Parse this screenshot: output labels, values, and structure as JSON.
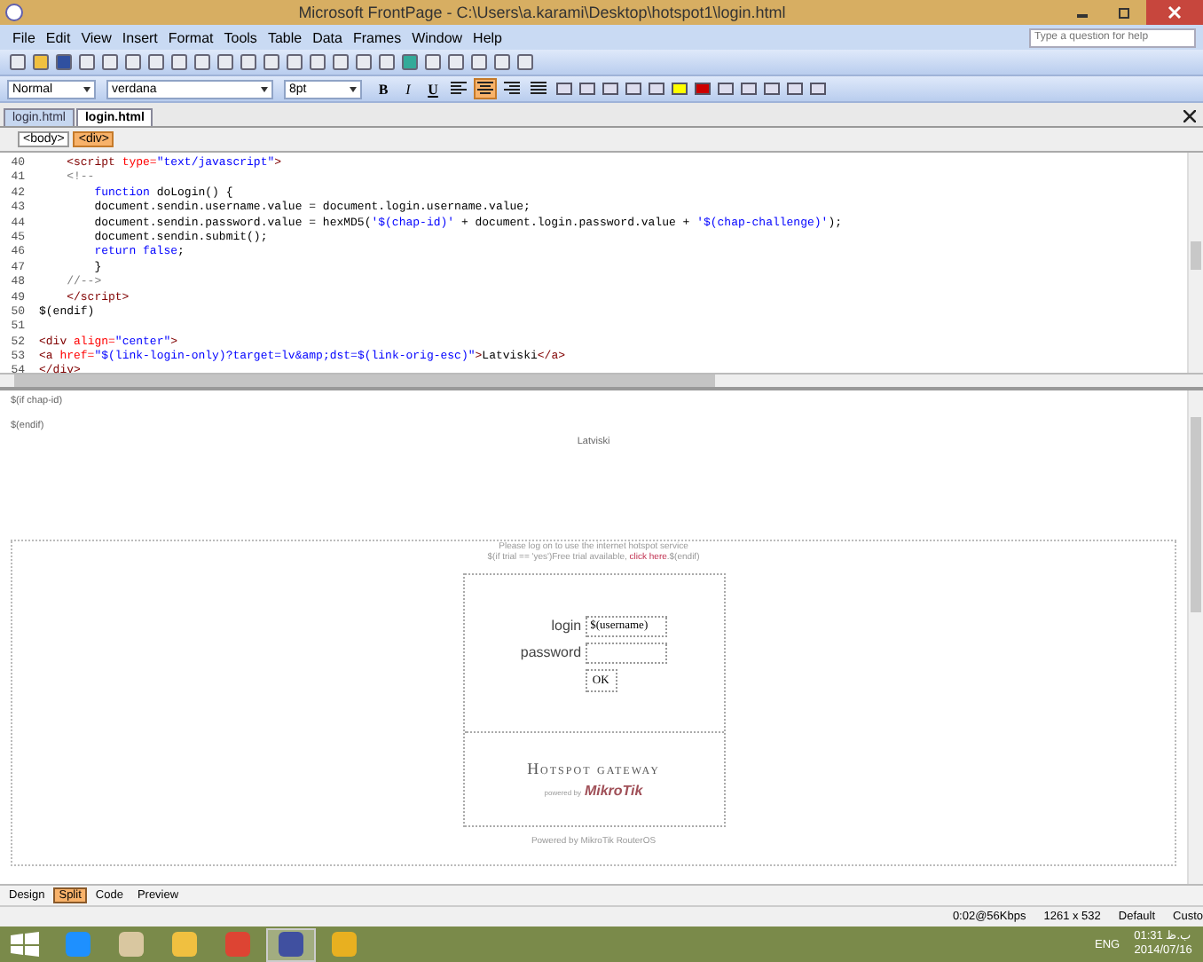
{
  "window": {
    "title": "Microsoft FrontPage - C:\\Users\\a.karami\\Desktop\\hotspot1\\login.html"
  },
  "menu": [
    "File",
    "Edit",
    "View",
    "Insert",
    "Format",
    "Tools",
    "Table",
    "Data",
    "Frames",
    "Window",
    "Help"
  ],
  "help_box": {
    "placeholder": "Type a question for help"
  },
  "format_bar": {
    "style": "Normal",
    "font": "verdana",
    "size": "8pt",
    "bold": "B",
    "italic": "I",
    "underline": "U",
    "alignment": [
      {
        "kind": "left",
        "selected": false
      },
      {
        "kind": "center",
        "selected": true
      },
      {
        "kind": "right",
        "selected": false
      },
      {
        "kind": "justify",
        "selected": false
      }
    ]
  },
  "doc_tabs": [
    {
      "label": "login.html",
      "selected": false
    },
    {
      "label": "login.html",
      "selected": true
    }
  ],
  "tag_path": [
    {
      "label": "<body>",
      "selected": false
    },
    {
      "label": "<div>",
      "selected": true
    }
  ],
  "code_lines": [
    {
      "num": "40",
      "segments": [
        {
          "kind": "tag",
          "text": "    <script "
        },
        {
          "kind": "attr",
          "text": "type="
        },
        {
          "kind": "string",
          "text": "\"text/javascript\""
        },
        {
          "kind": "tag",
          "text": ">"
        }
      ]
    },
    {
      "num": "41",
      "segments": [
        {
          "kind": "comment",
          "text": "    <!--"
        }
      ]
    },
    {
      "num": "42",
      "segments": [
        {
          "kind": "keyword",
          "text": "        function "
        },
        {
          "kind": "text",
          "text": "doLogin() {"
        }
      ]
    },
    {
      "num": "43",
      "segments": [
        {
          "kind": "text",
          "text": "        document.sendin.username.value = document.login.username.value;"
        }
      ]
    },
    {
      "num": "44",
      "segments": [
        {
          "kind": "text",
          "text": "        document.sendin.password.value = hexMD5("
        },
        {
          "kind": "string",
          "text": "'$(chap-id)'"
        },
        {
          "kind": "text",
          "text": " + document.login.password.value + "
        },
        {
          "kind": "string",
          "text": "'$(chap-challenge)'"
        },
        {
          "kind": "text",
          "text": ");"
        }
      ]
    },
    {
      "num": "45",
      "segments": [
        {
          "kind": "text",
          "text": "        document.sendin.submit();"
        }
      ]
    },
    {
      "num": "46",
      "segments": [
        {
          "kind": "keyword",
          "text": "        return false"
        },
        {
          "kind": "text",
          "text": ";"
        }
      ]
    },
    {
      "num": "47",
      "segments": [
        {
          "kind": "text",
          "text": "        }"
        }
      ]
    },
    {
      "num": "48",
      "segments": [
        {
          "kind": "comment",
          "text": "    //-->"
        }
      ]
    },
    {
      "num": "49",
      "segments": [
        {
          "kind": "tag",
          "text": "    </script>"
        }
      ]
    },
    {
      "num": "50",
      "segments": [
        {
          "kind": "text",
          "text": "$(endif)"
        }
      ]
    },
    {
      "num": "51"
    },
    {
      "num": "52",
      "segments": [
        {
          "kind": "tag",
          "text": "<div "
        },
        {
          "kind": "attr",
          "text": "align="
        },
        {
          "kind": "string",
          "text": "\"center\""
        },
        {
          "kind": "tag",
          "text": ">"
        }
      ]
    },
    {
      "num": "53",
      "segments": [
        {
          "kind": "tag",
          "text": "<a "
        },
        {
          "kind": "attr",
          "text": "href="
        },
        {
          "kind": "string",
          "text": "\"$(link-login-only)?target=lv&amp;dst=$(link-orig-esc)\""
        },
        {
          "kind": "tag",
          "text": ">"
        },
        {
          "kind": "text",
          "text": "Latviski"
        },
        {
          "kind": "tag",
          "text": "</a>"
        }
      ]
    },
    {
      "num": "54",
      "segments": [
        {
          "kind": "tag",
          "text": "</div>"
        }
      ]
    }
  ],
  "design": {
    "if_chap": "$(if chap-id)",
    "endif": "$(endif)",
    "language_link": "Latviski",
    "notice": "Please log on to use the internet hotspot service",
    "trial": "$(if trial == 'yes')Free trial available, ",
    "trial_link": "click here",
    "trial_end": ".$(endif)",
    "login_label": "login",
    "login_value": "$(username)",
    "password_label": "password",
    "ok_button": "OK",
    "gateway_title": "Hotspot gateway",
    "powered_small": "powered by",
    "brand": "MikroTik",
    "footer": "Powered by MikroTik RouterOS"
  },
  "view_tabs": [
    {
      "label": "Design",
      "selected": false
    },
    {
      "label": "Split",
      "selected": true
    },
    {
      "label": "Code",
      "selected": false
    },
    {
      "label": "Preview",
      "selected": false
    }
  ],
  "status_bar": [
    "0:02@56Kbps",
    "1261 x 532",
    "Default",
    "Custo"
  ],
  "taskbar": {
    "apps": [
      {
        "kind": "ie",
        "active": false
      },
      {
        "kind": "printer",
        "active": false
      },
      {
        "kind": "folder",
        "active": false
      },
      {
        "kind": "chrome",
        "active": false
      },
      {
        "kind": "frontpage",
        "active": true
      },
      {
        "kind": "explorer",
        "active": false
      }
    ],
    "language": "ENG",
    "time": "01:31 ب.ظ",
    "date": "2014/07/16"
  }
}
